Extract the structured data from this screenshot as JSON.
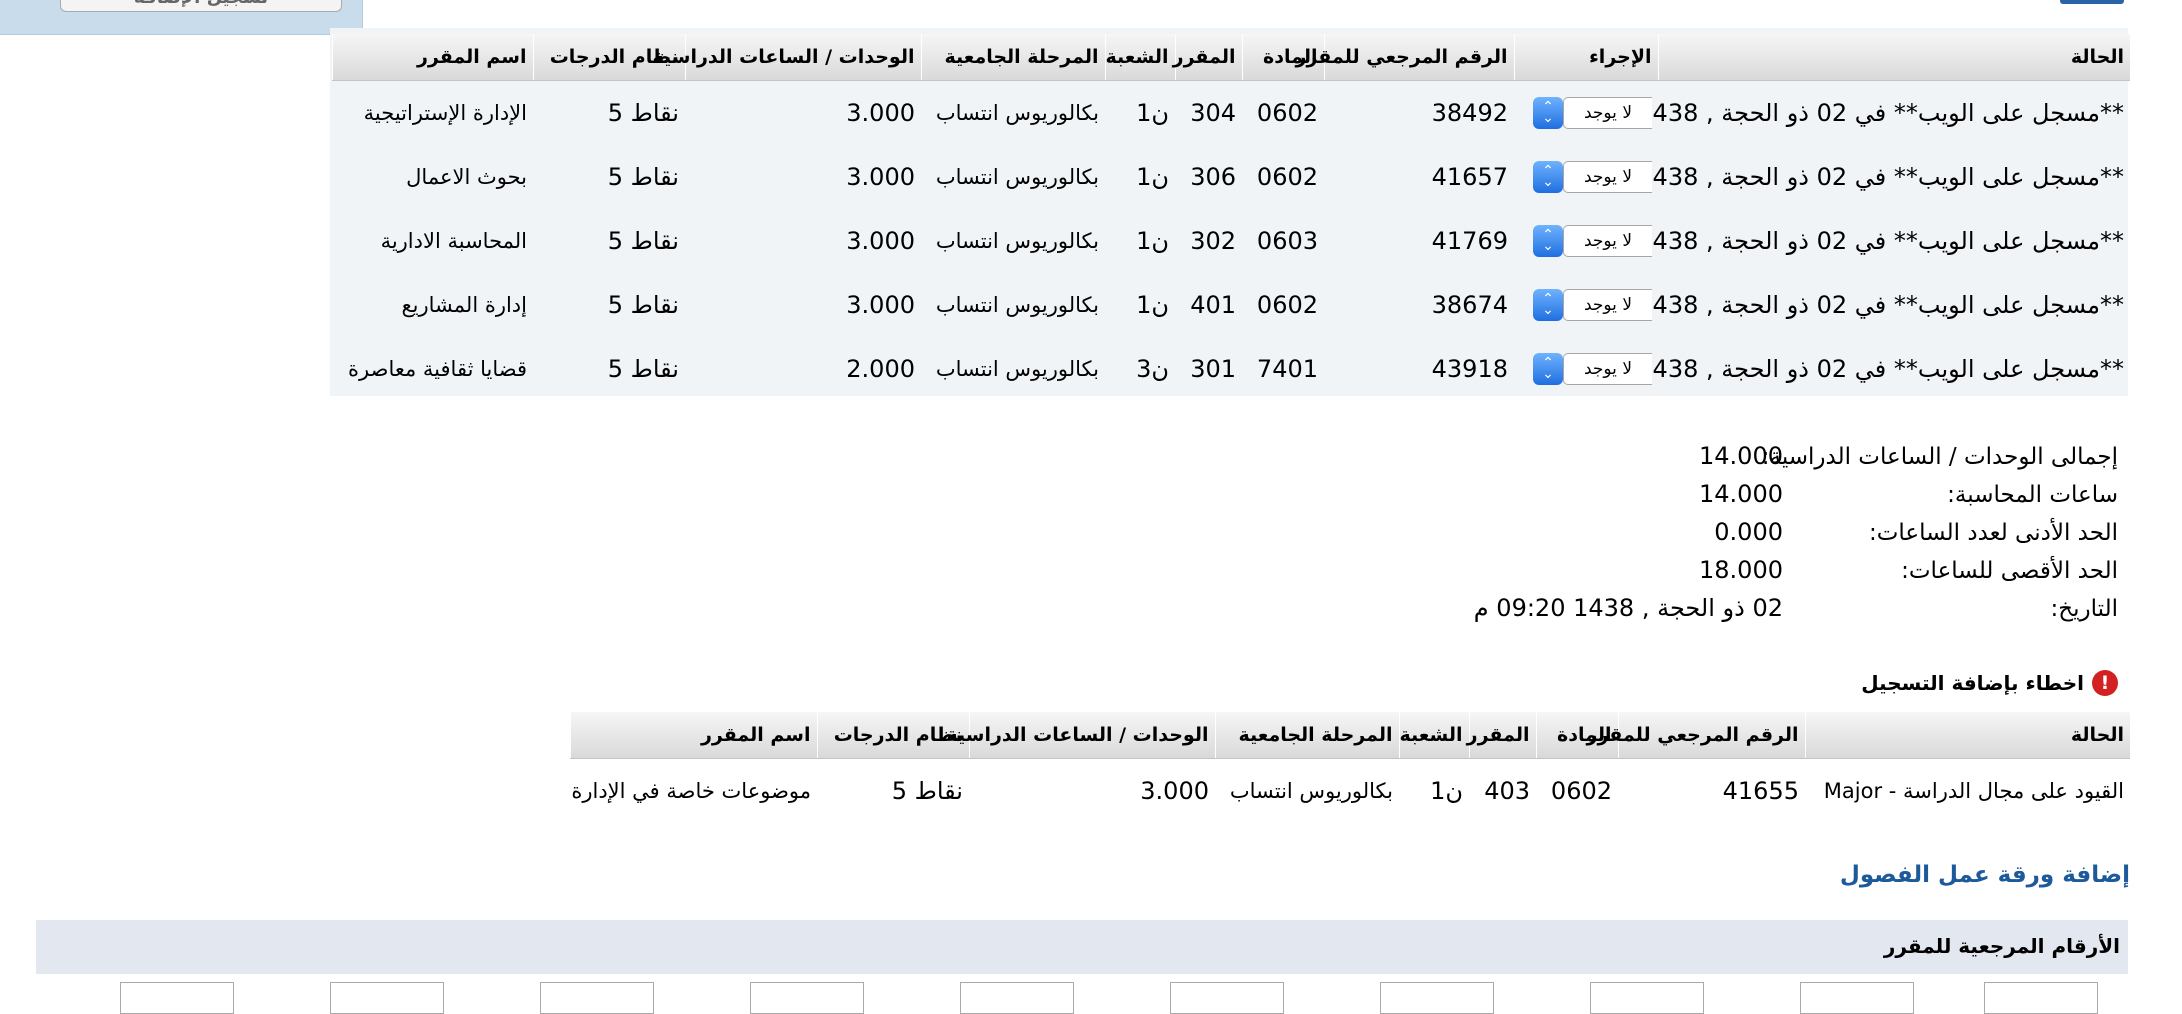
{
  "top": {
    "button_label": "تسجيل الإضافة"
  },
  "main_table": {
    "headers": [
      "الحالة",
      "الإجراء",
      "الرقم المرجعي للمقرر",
      "المادة",
      "المقرر",
      "الشعبة",
      "المرحلة الجامعية",
      "الوحدات / الساعات الدراسية",
      "نظام الدرجات",
      "اسم المقرر"
    ],
    "rows": [
      {
        "status": "**مسجل على الويب** في 02 ذو الحجة , 1438",
        "action": "لا يوجد",
        "crn": "38492",
        "subject": "0602",
        "course": "304",
        "section": "ن1",
        "level": "بكالوريوس انتساب",
        "hours": "3.000",
        "grading": "نقاط 5",
        "title": "الإدارة الإستراتيجية"
      },
      {
        "status": "**مسجل على الويب** في 02 ذو الحجة , 1438",
        "action": "لا يوجد",
        "crn": "41657",
        "subject": "0602",
        "course": "306",
        "section": "ن1",
        "level": "بكالوريوس انتساب",
        "hours": "3.000",
        "grading": "نقاط 5",
        "title": "بحوث الاعمال"
      },
      {
        "status": "**مسجل على الويب** في 02 ذو الحجة , 1438",
        "action": "لا يوجد",
        "crn": "41769",
        "subject": "0603",
        "course": "302",
        "section": "ن1",
        "level": "بكالوريوس انتساب",
        "hours": "3.000",
        "grading": "نقاط 5",
        "title": "المحاسبة الادارية"
      },
      {
        "status": "**مسجل على الويب** في 02 ذو الحجة , 1438",
        "action": "لا يوجد",
        "crn": "38674",
        "subject": "0602",
        "course": "401",
        "section": "ن1",
        "level": "بكالوريوس انتساب",
        "hours": "3.000",
        "grading": "نقاط 5",
        "title": "إدارة المشاريع"
      },
      {
        "status": "**مسجل على الويب** في 02 ذو الحجة , 1438",
        "action": "لا يوجد",
        "crn": "43918",
        "subject": "7401",
        "course": "301",
        "section": "ن3",
        "level": "بكالوريوس انتساب",
        "hours": "2.000",
        "grading": "نقاط 5",
        "title": "قضايا ثقافية معاصرة"
      }
    ]
  },
  "summary": {
    "total_label": "إجمالى الوحدات / الساعات الدراسية:",
    "total_value": "14.000",
    "billing_label": "ساعات المحاسبة:",
    "billing_value": "14.000",
    "min_label": "الحد الأدنى لعدد الساعات:",
    "min_value": "0.000",
    "max_label": "الحد الأقصى للساعات:",
    "max_value": "18.000",
    "date_label": "التاريخ:",
    "date_value": "02 ذو الحجة , 1438 09:20 م"
  },
  "errors": {
    "title": "اخطاء بإضافة التسجيل",
    "icon_glyph": "!",
    "headers": [
      "الحالة",
      "الرقم المرجعي للمقرر",
      "المادة",
      "المقرر",
      "الشعبة",
      "المرحلة الجامعية",
      "الوحدات / الساعات الدراسية",
      "نظام الدرجات",
      "اسم المقرر"
    ],
    "rows": [
      {
        "status": "القيود على مجال الدراسة - Major",
        "crn": "41655",
        "subject": "0602",
        "course": "403",
        "section": "ن1",
        "level": "بكالوريوس انتساب",
        "hours": "3.000",
        "grading": "نقاط 5",
        "title": "موضوعات خاصة في الإدارة"
      }
    ]
  },
  "worksheet": {
    "title": "إضافة ورقة عمل الفصول",
    "crn_label": "الأرقام المرجعية للمقرر"
  },
  "colors": {
    "accent_blue": "#1c5a9a",
    "header_band": "#e3e7ef",
    "sheet_bg": "#f1f4f7",
    "error_red": "#d32020"
  }
}
